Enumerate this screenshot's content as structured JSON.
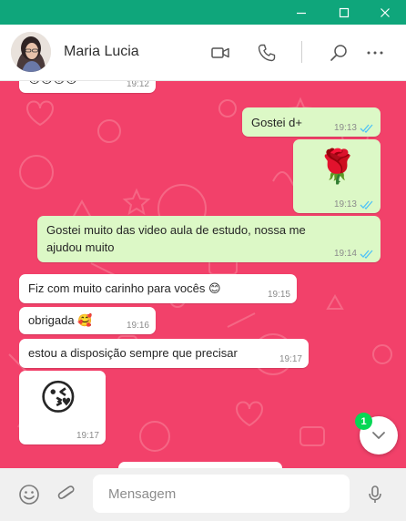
{
  "theme": {
    "titlebar_color": "#0fa67b",
    "chat_background": "#f2416a",
    "outgoing_bubble": "#dcf8c6",
    "incoming_bubble": "#ffffff",
    "read_tick_color": "#4fc3f7",
    "badge_color": "#06d755"
  },
  "window_controls": {
    "minimize_icon": "minimize-icon",
    "maximize_icon": "maximize-icon",
    "close_icon": "close-icon"
  },
  "header": {
    "contact_name": "Maria Lucia",
    "icons": [
      "video-call-icon",
      "voice-call-icon",
      "search-icon",
      "more-options-icon"
    ]
  },
  "messages": [
    {
      "direction": "in",
      "text": "",
      "emoji": "😘😘😘😘",
      "time": "19:12",
      "partial": true
    },
    {
      "direction": "out",
      "text": "Gostei d+",
      "time": "19:13",
      "status": "read"
    },
    {
      "direction": "out",
      "text": "",
      "emoji": "🌹",
      "time": "19:13",
      "status": "read"
    },
    {
      "direction": "out",
      "text": "Gostei muito das video aula de estudo, nossa me ajudou muito",
      "time": "19:14",
      "status": "read"
    },
    {
      "direction": "in",
      "text": "Fiz com muito carinho para vocês 😊",
      "time": "19:15"
    },
    {
      "direction": "in",
      "text": "obrigada 🥰",
      "time": "19:16"
    },
    {
      "direction": "in",
      "text": "estou a disposição sempre que precisar",
      "time": "19:17"
    },
    {
      "direction": "in",
      "text": "",
      "emoji": "😘",
      "time": "19:17"
    }
  ],
  "scroll_down": {
    "unread_count": "1",
    "icon": "chevron-down-icon"
  },
  "composer": {
    "placeholder": "Mensagem",
    "value": "",
    "icons": [
      "emoji-icon",
      "attach-icon",
      "microphone-icon"
    ]
  }
}
